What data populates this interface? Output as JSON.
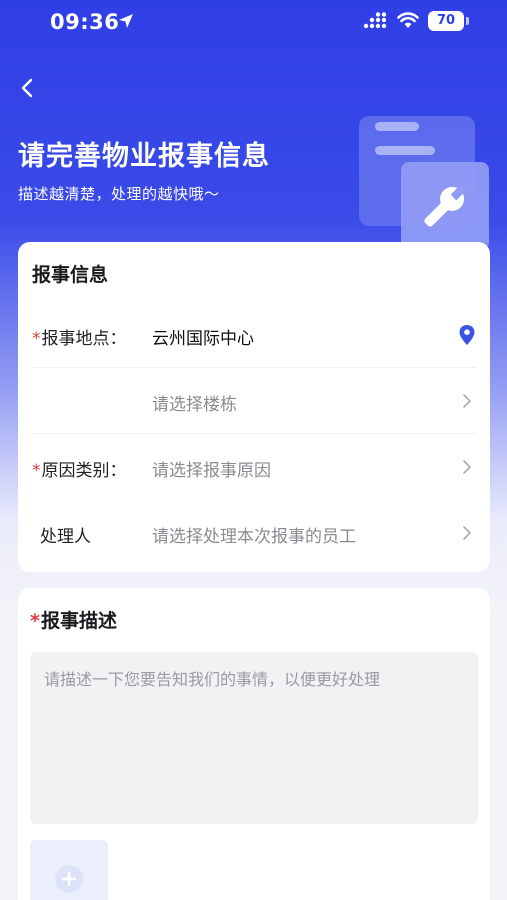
{
  "status_bar": {
    "time": "09:36",
    "battery": "70"
  },
  "header": {
    "title": "请完善物业报事信息",
    "subtitle": "描述越清楚，处理的越快哦～"
  },
  "report_info": {
    "section_title": "报事信息",
    "rows": [
      {
        "required": true,
        "label": "报事地点：",
        "value": "云州国际中心",
        "icon": "location-pin-icon"
      },
      {
        "required": false,
        "label": "",
        "value": "请选择楼栋",
        "icon": "chevron-right-icon"
      },
      {
        "required": true,
        "label": "原因类别：",
        "value": "请选择报事原因",
        "icon": "chevron-right-icon"
      },
      {
        "required": false,
        "label": "处理人",
        "value": "请选择处理本次报事的员工",
        "icon": "chevron-right-icon"
      }
    ]
  },
  "description": {
    "section_title": "报事描述",
    "required_mark": "*",
    "placeholder": "请描述一下您要告知我们的事情，以便更好处理"
  },
  "colors": {
    "primary": "#2f3fe6",
    "required": "#e0393e",
    "accent_pin": "#3a54e8"
  }
}
